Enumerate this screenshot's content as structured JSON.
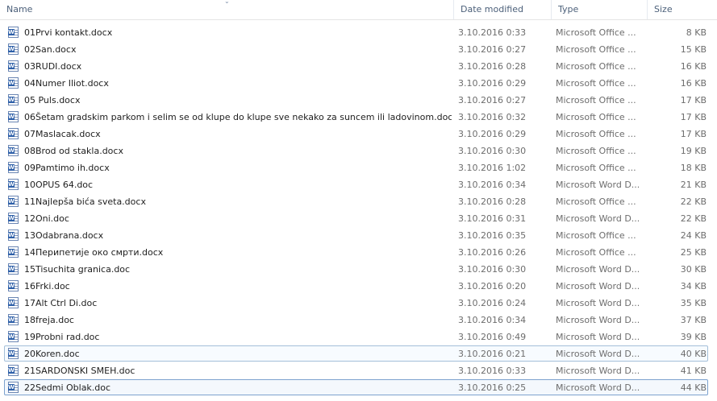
{
  "columns": {
    "name": "Name",
    "date": "Date modified",
    "type": "Type",
    "size": "Size"
  },
  "files": [
    {
      "name": "01Prvi kontakt.docx",
      "date": "3.10.2016 0:33",
      "type": "Microsoft Office ...",
      "size": "8 KB"
    },
    {
      "name": "02San.docx",
      "date": "3.10.2016 0:27",
      "type": "Microsoft Office ...",
      "size": "15 KB"
    },
    {
      "name": "03RUDI.docx",
      "date": "3.10.2016 0:28",
      "type": "Microsoft Office ...",
      "size": "16 KB"
    },
    {
      "name": "04Numer Iliot.docx",
      "date": "3.10.2016 0:29",
      "type": "Microsoft Office ...",
      "size": "16 KB"
    },
    {
      "name": "05 Puls.docx",
      "date": "3.10.2016 0:27",
      "type": "Microsoft Office ...",
      "size": "17 KB"
    },
    {
      "name": "06Šetam gradskim parkom i selim se od klupe do klupe sve nekako za suncem ili ladovinom.docx",
      "date": "3.10.2016 0:32",
      "type": "Microsoft Office ...",
      "size": "17 KB"
    },
    {
      "name": "07Maslacak.docx",
      "date": "3.10.2016 0:29",
      "type": "Microsoft Office ...",
      "size": "17 KB"
    },
    {
      "name": "08Brod od stakla.docx",
      "date": "3.10.2016 0:30",
      "type": "Microsoft Office ...",
      "size": "19 KB"
    },
    {
      "name": "09Pamtimo ih.docx",
      "date": "3.10.2016 1:02",
      "type": "Microsoft Office ...",
      "size": "18 KB"
    },
    {
      "name": "10OPUS 64.doc",
      "date": "3.10.2016 0:34",
      "type": "Microsoft Word D...",
      "size": "21 KB"
    },
    {
      "name": "11Najlepša bića sveta.docx",
      "date": "3.10.2016 0:28",
      "type": "Microsoft Office ...",
      "size": "22 KB"
    },
    {
      "name": "12Oni.doc",
      "date": "3.10.2016 0:31",
      "type": "Microsoft Word D...",
      "size": "22 KB"
    },
    {
      "name": "13Odabrana.docx",
      "date": "3.10.2016 0:35",
      "type": "Microsoft Office ...",
      "size": "24 KB"
    },
    {
      "name": "14Перипетије око смрти.docx",
      "date": "3.10.2016 0:26",
      "type": "Microsoft Office ...",
      "size": "25 KB"
    },
    {
      "name": "15Tisuchita granica.doc",
      "date": "3.10.2016 0:30",
      "type": "Microsoft Word D...",
      "size": "30 KB"
    },
    {
      "name": "16Frki.doc",
      "date": "3.10.2016 0:20",
      "type": "Microsoft Word D...",
      "size": "34 KB"
    },
    {
      "name": "17Alt Ctrl Di.doc",
      "date": "3.10.2016 0:24",
      "type": "Microsoft Word D...",
      "size": "35 KB"
    },
    {
      "name": "18freja.doc",
      "date": "3.10.2016 0:34",
      "type": "Microsoft Word D...",
      "size": "37 KB"
    },
    {
      "name": "19Probni rad.doc",
      "date": "3.10.2016 0:49",
      "type": "Microsoft Word D...",
      "size": "39 KB"
    },
    {
      "name": "20Koren.doc",
      "date": "3.10.2016 0:21",
      "type": "Microsoft Word D...",
      "size": "40 KB"
    },
    {
      "name": "21SARDONSKI SMEH.doc",
      "date": "3.10.2016 0:33",
      "type": "Microsoft Word D...",
      "size": "41 KB"
    },
    {
      "name": "22Sedmi Oblak.doc",
      "date": "3.10.2016 0:25",
      "type": "Microsoft Word D...",
      "size": "44 KB"
    }
  ],
  "selected_rows": [
    19
  ],
  "focused_rows": [
    21
  ],
  "icon": "word-document-icon",
  "colors": {
    "header_text": "#4c607a",
    "secondary_text": "#6d6d6d",
    "selection_border": "#a4bfd9",
    "word_blue": "#2d5fa8"
  }
}
